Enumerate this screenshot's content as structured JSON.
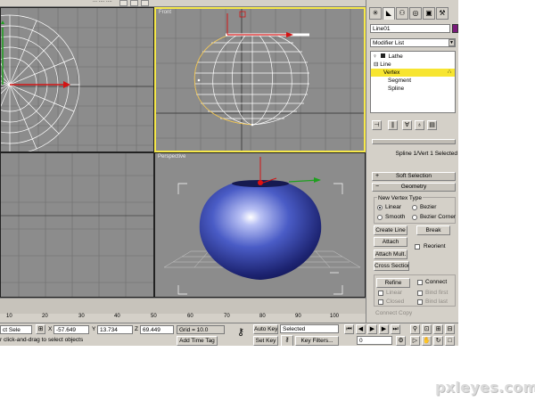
{
  "toolbar": {
    "partial_label": "....",
    "scroll_text": "...  ....  ...."
  },
  "viewports": {
    "top": {
      "label": ""
    },
    "front": {
      "label": "Front"
    },
    "left": {
      "label": ""
    },
    "perspective": {
      "label": "Perspective"
    }
  },
  "timeline": {
    "ticks": [
      "10",
      "20",
      "30",
      "40",
      "50",
      "60",
      "70",
      "80",
      "90",
      "100"
    ]
  },
  "status": {
    "selection_text": "ct Sele",
    "prompt": "r click-and-drag to select objects",
    "x_label": "X",
    "x_value": "-57.649",
    "y_label": "Y",
    "y_value": "13.734",
    "z_label": "Z",
    "z_value": "69.449",
    "grid": "Grid = 10.0",
    "add_time_tag": "Add Time Tag",
    "auto_key": "Auto Key",
    "auto_key_mode": "Selected",
    "set_key": "Set Key",
    "key_filters": "Key Filters...",
    "frame": "0"
  },
  "panel": {
    "object_name": "Line01",
    "modifier_list": "Modifier List",
    "stack": [
      {
        "label": "Lathe"
      },
      {
        "label": "Line"
      },
      {
        "label": "Vertex"
      },
      {
        "label": "Segment"
      },
      {
        "label": "Spline"
      }
    ],
    "selection_info": "Spline 1/Vert 1 Selected",
    "soft_selection": "Soft Selection",
    "geometry": "Geometry",
    "vertex_type": {
      "title": "New Vertex Type",
      "linear": "Linear",
      "bezier": "Bezier",
      "smooth": "Smooth",
      "bezier_corner": "Bezier Corner"
    },
    "create_line": "Create Line",
    "break": "Break",
    "attach": "Attach",
    "reorient": "Reorient",
    "attach_mult": "Attach Mult.",
    "cross_section": "Cross Section",
    "refine": "Refine",
    "connect": "Connect",
    "linear": "Linear",
    "bind_first": "Bind first",
    "closed": "Closed",
    "bind_last": "Bind last",
    "connect_copy": "Connect Copy"
  },
  "watermark": "pxleyes.com",
  "colors": {
    "active_viewport": "#f6e84a",
    "selection": "#f7e531",
    "vase": "#4a5cc6",
    "viewport_bg": "#8c8c8c"
  }
}
